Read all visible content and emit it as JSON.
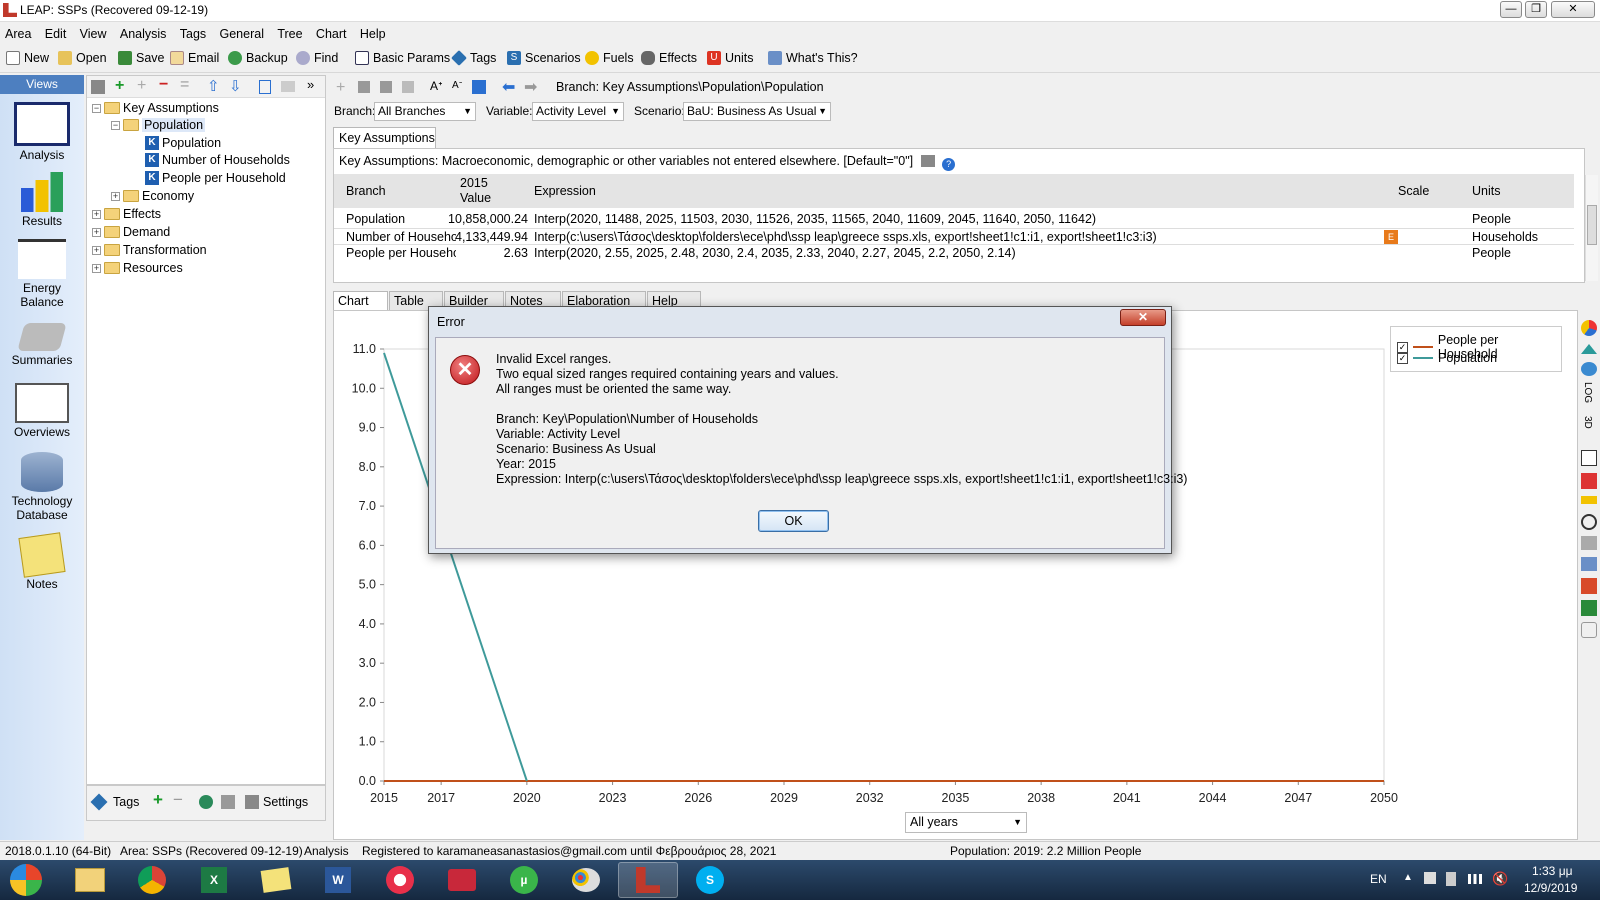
{
  "window": {
    "title": "LEAP: SSPs (Recovered 09-12-19)"
  },
  "menu": [
    "Area",
    "Edit",
    "View",
    "Analysis",
    "Tags",
    "General",
    "Tree",
    "Chart",
    "Help"
  ],
  "toolbar": {
    "new": "New",
    "open": "Open",
    "save": "Save",
    "email": "Email",
    "backup": "Backup",
    "find": "Find",
    "basic_params": "Basic Params",
    "tags": "Tags",
    "scenarios": "Scenarios",
    "fuels": "Fuels",
    "effects": "Effects",
    "units": "Units",
    "whats_this": "What's This?"
  },
  "views": {
    "header": "Views",
    "items": [
      "Analysis",
      "Results",
      "Energy Balance",
      "Summaries",
      "Overviews",
      "Technology Database",
      "Notes"
    ]
  },
  "tree": {
    "key_assumptions": "Key Assumptions",
    "population_folder": "Population",
    "population": "Population",
    "households": "Number of Households",
    "people_per_household": "People per Household",
    "economy": "Economy",
    "effects": "Effects",
    "demand": "Demand",
    "transformation": "Transformation",
    "resources": "Resources"
  },
  "tree_bottom": {
    "tags": "Tags",
    "settings": "Settings"
  },
  "branch_path": "Branch: Key Assumptions\\Population\\Population",
  "selectors": {
    "branch_label": "Branch:",
    "branch_value": "All Branches",
    "variable_label": "Variable:",
    "variable_value": "Activity Level",
    "scenario_label": "Scenario:",
    "scenario_value": "BaU: Business As Usual"
  },
  "ka_tab": "Key Assumptions",
  "ka_desc": "Key Assumptions: Macroeconomic, demographic or other variables not entered elsewhere. [Default=\"0\"]",
  "table": {
    "headers": {
      "branch": "Branch",
      "value_year": "2015",
      "value": "Value",
      "expression": "Expression",
      "scale": "Scale",
      "units": "Units"
    },
    "rows": [
      {
        "branch": "Population",
        "value": "10,858,000.24",
        "expression": "Interp(2020, 11488, 2025, 11503, 2030, 11526, 2035, 11565, 2040, 11609, 2045, 11640, 2050, 11642)",
        "units": "People"
      },
      {
        "branch": "Number of Househo",
        "value": "4,133,449.94",
        "expression": "Interp(c:\\users\\Τάσος\\desktop\\folders\\ece\\phd\\ssp leap\\greece ssps.xls, export!sheet1!c1:i1, export!sheet1!c3:i3)",
        "units": "Households"
      },
      {
        "branch": "People per Househol",
        "value": "2.63",
        "expression": "Interp(2020, 2.55,  2025, 2.48, 2030, 2.4, 2035, 2.33, 2040, 2.27, 2045, 2.2, 2050, 2.14)",
        "units": "People"
      }
    ]
  },
  "lower_tabs": [
    "Chart",
    "Table",
    "Builder",
    "Notes",
    "Elaboration",
    "Help"
  ],
  "chart_data": {
    "type": "line",
    "title": "",
    "xlabel": "",
    "ylabel": "",
    "x_ticks": [
      "2015",
      "2017",
      "2020",
      "2023",
      "2026",
      "2029",
      "2032",
      "2035",
      "2038",
      "2041",
      "2044",
      "2047",
      "2050"
    ],
    "y_ticks": [
      "0.0",
      "1.0",
      "2.0",
      "3.0",
      "4.0",
      "5.0",
      "6.0",
      "7.0",
      "8.0",
      "9.0",
      "10.0",
      "11.0"
    ],
    "xlim": [
      2015,
      2050
    ],
    "ylim": [
      0,
      11
    ],
    "series": [
      {
        "name": "People per Household",
        "color": "#c0501a",
        "x": [
          2015,
          2050
        ],
        "y": [
          0,
          0
        ]
      },
      {
        "name": "Population",
        "color": "#3f9a9a",
        "x": [
          2015,
          2020
        ],
        "y": [
          10.9,
          0
        ]
      }
    ]
  },
  "legend": [
    {
      "label": "People per Household",
      "color": "#c0501a"
    },
    {
      "label": "Population",
      "color": "#3f9a9a"
    }
  ],
  "years_select": "All years",
  "status": {
    "version": "2018.0.1.10 (64-Bit)",
    "area": "Area: SSPs (Recovered 09-12-19)",
    "mode": "Analysis",
    "registered": "Registered to karamaneasanastasios@gmail.com until Φεβρουάριος 28, 2021",
    "population": "Population: 2019: 2.2 Million People"
  },
  "taskbar": {
    "lang": "EN",
    "time": "1:33 μμ",
    "date": "12/9/2019"
  },
  "dialog": {
    "title": "Error",
    "lines": [
      "Invalid Excel ranges.",
      "Two equal sized ranges required containing years and values.",
      "All ranges must be oriented the same way.",
      "",
      "Branch: Key\\Population\\Number of Households",
      "Variable: Activity Level",
      "Scenario: Business As Usual",
      "Year: 2015",
      "Expression: Interp(c:\\users\\Τάσος\\desktop\\folders\\ece\\phd\\ssp leap\\greece ssps.xls, export!sheet1!c1:i1, export!sheet1!c3:i3)"
    ],
    "ok": "OK"
  }
}
